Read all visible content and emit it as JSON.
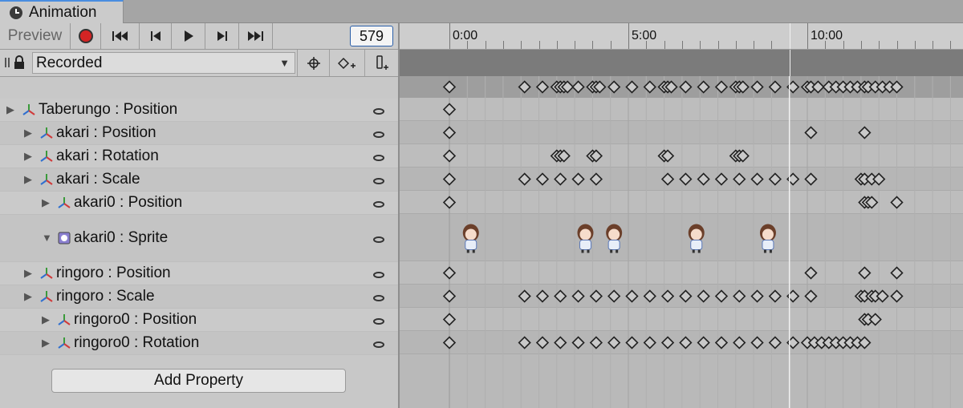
{
  "tab": {
    "title": "Animation",
    "icon": "clock-icon"
  },
  "toolbar": {
    "preview_label": "Preview",
    "frame_value": "579",
    "record_color": "#d42424"
  },
  "recorded_row": {
    "clip_name": "Recorded",
    "buttons": [
      "crosshair-icon",
      "add-keyframe-icon",
      "add-event-icon"
    ]
  },
  "properties": [
    {
      "label": "Taberungo : Position",
      "indent": 0,
      "icon": "transform-axes-icon"
    },
    {
      "label": "akari : Position",
      "indent": 1,
      "icon": "transform-axes-icon"
    },
    {
      "label": "akari : Rotation",
      "indent": 1,
      "icon": "transform-axes-icon"
    },
    {
      "label": "akari : Scale",
      "indent": 1,
      "icon": "transform-axes-icon"
    },
    {
      "label": "akari0 : Position",
      "indent": 2,
      "icon": "transform-axes-icon"
    },
    {
      "label": "akari0 : Sprite",
      "indent": 2,
      "icon": "sprite-renderer-icon",
      "expanded": true
    },
    {
      "label": "ringoro : Position",
      "indent": 1,
      "icon": "transform-axes-icon"
    },
    {
      "label": "ringoro : Scale",
      "indent": 1,
      "icon": "transform-axes-icon"
    },
    {
      "label": "ringoro0 : Position",
      "indent": 2,
      "icon": "transform-axes-icon"
    },
    {
      "label": "ringoro0 : Rotation",
      "indent": 2,
      "icon": "transform-axes-icon"
    }
  ],
  "add_property_label": "Add Property",
  "timeline": {
    "tick_labels": [
      "0:00",
      "5:00",
      "10:00"
    ],
    "playhead_time": 9.5,
    "keyframes": {
      "summary": [
        0,
        2.1,
        2.6,
        3.0,
        3.1,
        3.2,
        3.3,
        3.6,
        4.0,
        4.1,
        4.2,
        4.6,
        5.1,
        5.6,
        6.0,
        6.1,
        6.2,
        6.6,
        7.1,
        7.6,
        8.0,
        8.1,
        8.2,
        8.6,
        9.1,
        9.6,
        10.0,
        10.1,
        10.3,
        10.6,
        10.8,
        11.0,
        11.2,
        11.4,
        11.6,
        11.7,
        11.9,
        12.1,
        12.3,
        12.5
      ],
      "rows": [
        [
          0
        ],
        [
          0,
          10.1,
          11.6
        ],
        [
          0,
          3.0,
          3.1,
          3.2,
          4.0,
          4.1,
          6.0,
          6.1,
          8.0,
          8.1,
          8.2
        ],
        [
          0,
          2.1,
          2.6,
          3.1,
          3.6,
          4.1,
          6.1,
          6.6,
          7.1,
          7.6,
          8.1,
          8.6,
          9.1,
          9.6,
          10.1,
          11.5,
          11.6,
          11.8,
          12.0
        ],
        [
          0,
          11.6,
          11.7,
          11.8,
          12.5
        ],
        [],
        [
          0,
          10.1,
          11.6,
          12.5
        ],
        [
          0,
          2.1,
          2.6,
          3.1,
          3.6,
          4.1,
          4.6,
          5.1,
          5.6,
          6.1,
          6.6,
          7.1,
          7.6,
          8.1,
          8.6,
          9.1,
          9.6,
          10.1,
          11.5,
          11.6,
          11.8,
          11.9,
          12.1,
          12.5
        ],
        [
          0,
          11.6,
          11.7,
          11.9
        ],
        [
          0,
          2.1,
          2.6,
          3.1,
          3.6,
          4.1,
          4.6,
          5.1,
          5.6,
          6.1,
          6.6,
          7.1,
          7.6,
          8.1,
          8.6,
          9.1,
          9.6,
          10.0,
          10.2,
          10.4,
          10.6,
          10.8,
          11.0,
          11.2,
          11.4,
          11.6
        ]
      ],
      "sprite_times": [
        0.6,
        3.8,
        4.6,
        6.9,
        8.9
      ]
    }
  }
}
